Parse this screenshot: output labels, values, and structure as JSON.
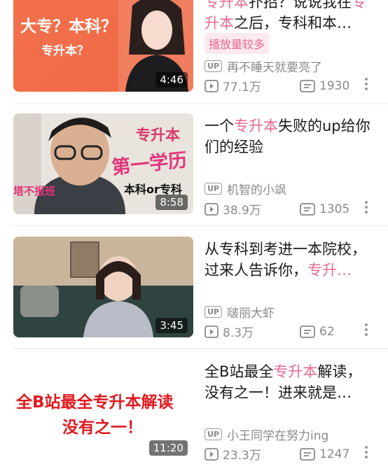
{
  "videos": [
    {
      "duration": "4:46",
      "thumb_text": [
        "大专？本科？",
        "专升本？"
      ],
      "title_parts": [
        {
          "text": "专升本",
          "hl": true
        },
        {
          "text": "扑招？说说我在",
          "hl": false
        },
        {
          "text": "专",
          "hl": true
        },
        {
          "text": "升本",
          "hl": true
        },
        {
          "text": "之后，专科和本…",
          "hl": false
        }
      ],
      "badge": "播放量较多",
      "up_label": "UP",
      "uploader": "再不睡天就要亮了",
      "views": "77.1万",
      "comments": "1930"
    },
    {
      "duration": "8:58",
      "thumb_text": [
        "专升本",
        "第一学历",
        "本科or专科",
        "塔不报班"
      ],
      "title_parts": [
        {
          "text": "一个",
          "hl": false
        },
        {
          "text": "专升本",
          "hl": true
        },
        {
          "text": "失败的up给你们的经验",
          "hl": false
        }
      ],
      "up_label": "UP",
      "uploader": "机智的小飒",
      "views": "38.9万",
      "comments": "1305"
    },
    {
      "duration": "3:45",
      "title_parts": [
        {
          "text": "从专科到考进一本院校，过来人告诉你，",
          "hl": false
        },
        {
          "text": "专升…",
          "hl": true
        }
      ],
      "up_label": "UP",
      "uploader": "啵丽大虾",
      "views": "8.3万",
      "comments": "62"
    },
    {
      "duration": "11:20",
      "thumb_text": [
        "全B站最全专升本解读",
        "没有之一！"
      ],
      "title_parts": [
        {
          "text": "全B站最全",
          "hl": false
        },
        {
          "text": "专升本",
          "hl": true
        },
        {
          "text": "解读，没有之一！进来就是…",
          "hl": false
        }
      ],
      "up_label": "UP",
      "uploader": "小王同学在努力ing",
      "views": "23.3万",
      "comments": "1247"
    }
  ],
  "icons": [
    "play-count-icon",
    "comment-count-icon",
    "more-icon"
  ],
  "colors": {
    "highlight": "#e86a92",
    "meta": "#8a8a8a",
    "badge_bg": "#fde9ef"
  }
}
